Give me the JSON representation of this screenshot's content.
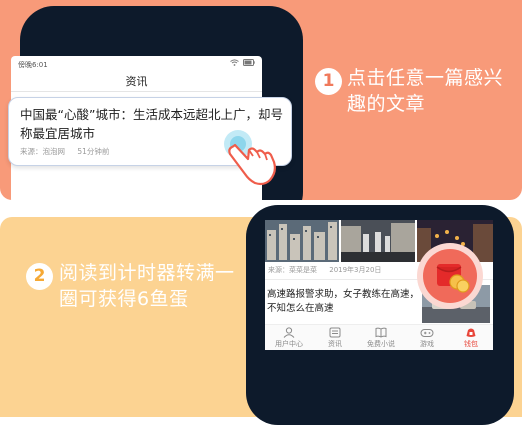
{
  "colors": {
    "panel1_bg": "#f89a79",
    "panel2_bg": "#fcd392",
    "phone_frame": "#0d1a2b",
    "accent_red": "#e8463a"
  },
  "step1": {
    "number": "1",
    "text": "点击任意一篇感兴趣的文章"
  },
  "step2": {
    "number": "2",
    "text": "阅读到计时器转满一圈可获得6鱼蛋"
  },
  "phone1": {
    "status_time": "傍晚6:01",
    "status_icons": "wifi-icon, battery-icon",
    "screen_title": "资讯"
  },
  "article_card": {
    "title": "中国最“心酸”城市：生活成本远超北上广，却号称最宜居城市",
    "source": "来源：泡泡网",
    "time": "51分钟前"
  },
  "phone2": {
    "meta_source": "来源：菜菜是菜",
    "meta_date": "2019年3月20日",
    "headline": "高速路报警求助，女子教练在高速，不知怎么在高速",
    "tabs": [
      {
        "label": "用户中心",
        "icon": "user-icon"
      },
      {
        "label": "资讯",
        "icon": "news-icon"
      },
      {
        "label": "免费小说",
        "icon": "book-icon"
      },
      {
        "label": "游戏",
        "icon": "gamepad-icon"
      },
      {
        "label": "钱包",
        "icon": "wallet-icon"
      }
    ],
    "active_tab": "钱包"
  },
  "timer": {
    "icon": "red-packet-icon"
  }
}
